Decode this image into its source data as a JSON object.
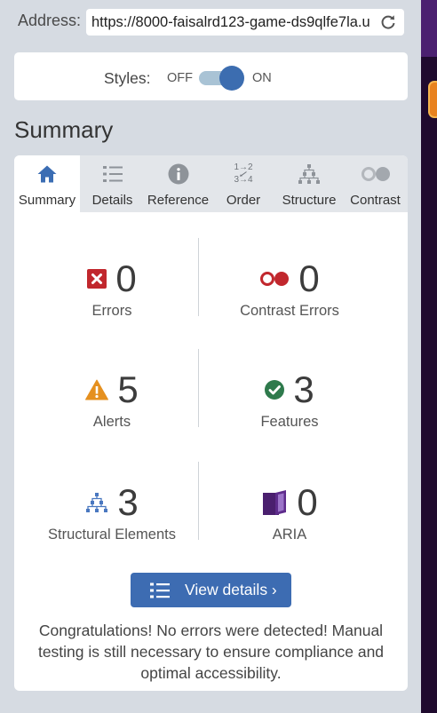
{
  "address": {
    "label": "Address:",
    "url": "https://8000-faisalrd123-game-ds9qlfe7la.u",
    "refresh_icon": "refresh-icon"
  },
  "styles": {
    "label": "Styles:",
    "off_label": "OFF",
    "on_label": "ON",
    "toggle_state": "on"
  },
  "heading": "Summary",
  "tabs": [
    {
      "label": "Summary",
      "icon": "home-icon",
      "active": true
    },
    {
      "label": "Details",
      "icon": "list-icon",
      "active": false
    },
    {
      "label": "Reference",
      "icon": "info-icon",
      "active": false
    },
    {
      "label": "Order",
      "icon": "order-icon",
      "icon_text": [
        "1→2",
        "3→4"
      ],
      "active": false
    },
    {
      "label": "Structure",
      "icon": "structure-icon",
      "active": false
    },
    {
      "label": "Contrast",
      "icon": "contrast-icon",
      "active": false
    }
  ],
  "summary": {
    "errors": {
      "count": "0",
      "label": "Errors",
      "icon": "error-icon"
    },
    "contrast_errors": {
      "count": "0",
      "label": "Contrast Errors",
      "icon": "contrast-error-icon"
    },
    "alerts": {
      "count": "5",
      "label": "Alerts",
      "icon": "alert-icon"
    },
    "features": {
      "count": "3",
      "label": "Features",
      "icon": "feature-icon"
    },
    "structural_elements": {
      "count": "3",
      "label": "Structural Elements",
      "icon": "structure-icon"
    },
    "aria": {
      "count": "0",
      "label": "ARIA",
      "icon": "aria-icon"
    }
  },
  "view_details": {
    "label": "View details ›",
    "icon": "list-icon"
  },
  "message_lines": [
    "Congratulations! No errors were detected! Manual",
    "testing is still necessary to ensure compliance and",
    "optimal accessibility."
  ],
  "colors": {
    "panel_bg": "#d6dbe2",
    "accent": "#3d6cb2",
    "error": "#c1272d",
    "alert": "#e5901f",
    "feature": "#2e7a4c",
    "structure": "#4a78c0",
    "aria": "#5e2c8c",
    "page_strip": "#1f0a2e"
  }
}
